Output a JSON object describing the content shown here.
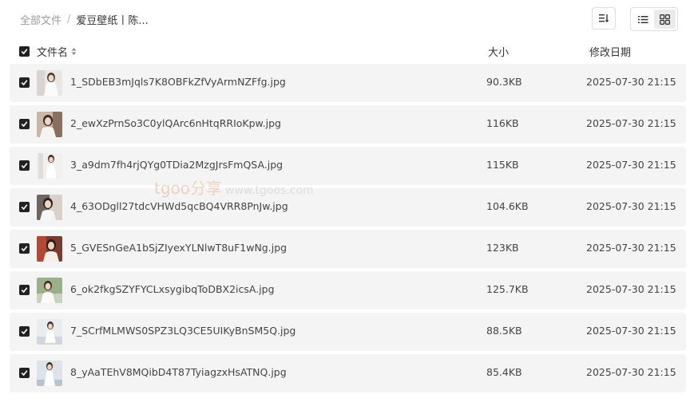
{
  "breadcrumb": {
    "root": "全部文件",
    "separator": "/",
    "current": "爱豆壁纸丨陈..."
  },
  "toolbar": {
    "sort_icon": "sort-icon",
    "list_view_icon": "list-view-icon",
    "grid_view_icon": "grid-view-icon",
    "active_view": "list"
  },
  "table": {
    "columns": {
      "name": "文件名",
      "size": "大小",
      "date": "修改日期"
    },
    "rows": [
      {
        "name": "1_SDbEB3mJqls7K8OBFkZfVyArmNZFfg.jpg",
        "size": "90.3KB",
        "date": "2025-07-30 21:15",
        "checked": true
      },
      {
        "name": "2_ewXzPrnSo3C0ylQArc6nHtqRRIoKpw.jpg",
        "size": "116KB",
        "date": "2025-07-30 21:15",
        "checked": true
      },
      {
        "name": "3_a9dm7fh4rjQYg0TDia2MzgJrsFmQSA.jpg",
        "size": "115KB",
        "date": "2025-07-30 21:15",
        "checked": true
      },
      {
        "name": "4_63ODgll27tdcVHWd5qcBQ4VRR8PnJw.jpg",
        "size": "104.6KB",
        "date": "2025-07-30 21:15",
        "checked": true
      },
      {
        "name": "5_GVESnGeA1bSjZIyexYLNlwT8uF1wNg.jpg",
        "size": "123KB",
        "date": "2025-07-30 21:15",
        "checked": true
      },
      {
        "name": "6_ok2fkgSZYFYCLxsygibqToDBX2icsA.jpg",
        "size": "125.7KB",
        "date": "2025-07-30 21:15",
        "checked": true
      },
      {
        "name": "7_SCrfMLMWS0SPZ3LQ3CE5UIKyBnSM5Q.jpg",
        "size": "88.5KB",
        "date": "2025-07-30 21:15",
        "checked": true
      },
      {
        "name": "8_yAaTEhV8MQibD4T87TyiagzxHsATNQ.jpg",
        "size": "85.4KB",
        "date": "2025-07-30 21:15",
        "checked": true
      }
    ]
  },
  "watermark": {
    "brand": "tgoo分享",
    "url": "www.tgoos.com"
  },
  "colors": {
    "row_bg": "#f4f4f4",
    "checkbox": "#222222",
    "muted_text": "#9a9a9a",
    "watermark_brand": "#e3b591"
  }
}
